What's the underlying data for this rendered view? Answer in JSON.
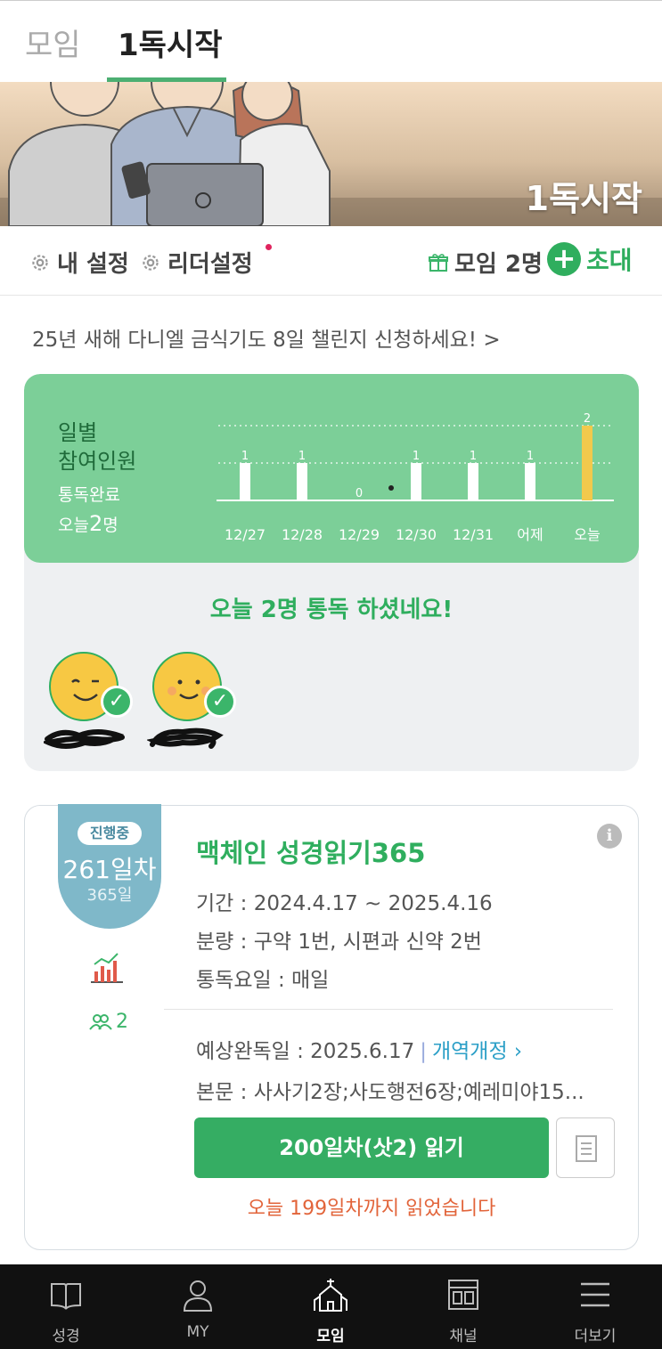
{
  "top_tabs": {
    "inactive": "모임",
    "active": "1독시작"
  },
  "banner": {
    "title": "1독시작"
  },
  "settings": {
    "my_settings": "내 설정",
    "leader_settings": "리더설정",
    "group_count": "모임 2명",
    "invite": "초대"
  },
  "notice": "25년 새해 다니엘 금식기도 8일 챌린지 신청하세요! >",
  "stats": {
    "title": "일별\n참여인원",
    "sub_label": "통독완료",
    "today_prefix": "오늘",
    "today_count": "2",
    "today_suffix": "명",
    "message": "오늘 2명 통독 하셨네요!"
  },
  "chart_data": {
    "type": "bar",
    "categories": [
      "12/27",
      "12/28",
      "12/29",
      "12/30",
      "12/31",
      "어제",
      "오늘"
    ],
    "values": [
      1,
      1,
      0,
      1,
      1,
      1,
      2
    ],
    "ylim": [
      0,
      2
    ],
    "colors": {
      "bar": "#ffffff",
      "highlight": "#f2c94c"
    }
  },
  "plan": {
    "status": "진행중",
    "day": "261일차",
    "total": "365일",
    "members": "2",
    "title": "맥체인 성경읽기365",
    "period": "기간 : 2024.4.17 ~ 2025.4.16",
    "amount": "분량 : 구약 1번, 시편과 신약 2번",
    "days": "통독요일 : 매일",
    "expected": "예상완독일 : 2025.6.17",
    "revision": "개역개정 ›",
    "text": "본문 : 사사기2장;사도행전6장;예레미야15...",
    "read_button": "200일차(삿2) 읽기",
    "today_read": "오늘 199일차까지 읽었습니다"
  },
  "nav": [
    {
      "label": "성경",
      "icon": "bible-icon"
    },
    {
      "label": "MY",
      "icon": "person-icon"
    },
    {
      "label": "모임",
      "icon": "church-icon"
    },
    {
      "label": "채널",
      "icon": "channel-icon"
    },
    {
      "label": "더보기",
      "icon": "menu-icon"
    }
  ]
}
